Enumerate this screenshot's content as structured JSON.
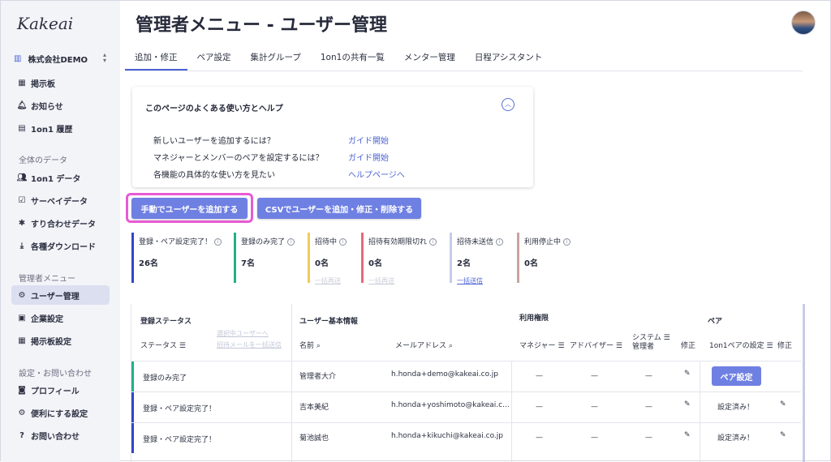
{
  "sidebar": {
    "logo": "Kakeai",
    "company": "株式会社DEMO",
    "items_top": [
      {
        "label": "掲示板",
        "icon": "dashboard-icon"
      },
      {
        "label": "お知らせ",
        "icon": "bell-icon"
      },
      {
        "label": "1on1 履歴",
        "icon": "history-icon"
      }
    ],
    "section_data": "全体のデータ",
    "items_data": [
      {
        "label": "1on1 データ",
        "icon": "people-icon"
      },
      {
        "label": "サーベイデータ",
        "icon": "survey-icon"
      },
      {
        "label": "すり合わせデータ",
        "icon": "puzzle-icon"
      },
      {
        "label": "各種ダウンロード",
        "icon": "download-icon"
      }
    ],
    "section_admin": "管理者メニュー",
    "items_admin": [
      {
        "label": "ユーザー管理",
        "icon": "user-manage-icon"
      },
      {
        "label": "企業設定",
        "icon": "company-icon"
      },
      {
        "label": "掲示板設定",
        "icon": "board-settings-icon"
      }
    ],
    "section_settings": "設定・お問い合わせ",
    "items_settings": [
      {
        "label": "プロフィール",
        "icon": "profile-icon"
      },
      {
        "label": "便利にする設定",
        "icon": "gear-icon"
      },
      {
        "label": "お問い合わせ",
        "icon": "help-icon"
      }
    ]
  },
  "header": {
    "title": "管理者メニュー - ユーザー管理"
  },
  "tabs": [
    "追加・修正",
    "ペア設定",
    "集計グループ",
    "1on1の共有一覧",
    "メンター管理",
    "日程アシスタント"
  ],
  "help": {
    "title": "このページのよくある使い方とヘルプ",
    "rows": [
      {
        "q": "新しいユーザーを追加するには？",
        "link": "ガイド開始"
      },
      {
        "q": "マネジャーとメンバーのペアを設定するには？",
        "link": "ガイド開始"
      },
      {
        "q": "各機能の具体的な使い方を見たい",
        "link": "ヘルプページへ"
      }
    ]
  },
  "actions": {
    "manual_add": "手動でユーザーを追加する",
    "csv": "CSVでユーザーを追加・修正・削除する"
  },
  "stats": [
    {
      "label": "登録・ペア設定完了！",
      "value": "26名",
      "sub": "",
      "color": "#3346c8"
    },
    {
      "label": "登録のみ完了",
      "value": "7名",
      "sub": "",
      "color": "#22b08a"
    },
    {
      "label": "招待中",
      "value": "0名",
      "sub": "一括再送",
      "color": "#f0cc5a"
    },
    {
      "label": "招待有効期限切れ",
      "value": "0名",
      "sub": "一括再送",
      "color": "#e56a7c"
    },
    {
      "label": "招待未送信",
      "value": "2名",
      "sub": "一括送信",
      "color": "#c6cbe8"
    },
    {
      "label": "利用停止中",
      "value": "0名",
      "sub": "",
      "color": "#c9a3a0"
    }
  ],
  "table": {
    "group_status": "登録ステータス",
    "group_user": "ユーザー基本情報",
    "group_perm": "利用権限",
    "group_pair": "ペア",
    "col_status": "ステータス",
    "faded_1": "選択中ユーザーへ",
    "faded_2": "招待メールを一括送信",
    "col_name": "名前",
    "col_email": "メールアドレス",
    "col_manager": "マネジャー",
    "col_advisor": "アドバイザー",
    "col_sysadmin_1": "システム",
    "col_sysadmin_2": "管理者",
    "col_edit": "修正",
    "col_pair_setting": "1on1ペアの設定",
    "col_pair_edit": "修正",
    "pair_button": "ペア設定",
    "rows": [
      {
        "status": "登録のみ完了",
        "name": "管理者大介",
        "email": "h.honda+demo@kakeai.co.jp",
        "manager": "—",
        "advisor": "—",
        "sysadmin": "—",
        "pair": "",
        "accent": "#22b08a"
      },
      {
        "status": "登録・ペア設定完了！",
        "name": "吉本美紀",
        "email": "h.honda+yoshimoto@kakeai.c...",
        "manager": "—",
        "advisor": "—",
        "sysadmin": "—",
        "pair": "設定済み！",
        "accent": "#3346c8"
      },
      {
        "status": "登録・ペア設定完了！",
        "name": "菊池誠也",
        "email": "h.honda+kikuchi@kakeai.co.jp",
        "manager": "—",
        "advisor": "—",
        "sysadmin": "—",
        "pair": "設定済み！",
        "accent": "#3346c8"
      }
    ]
  }
}
